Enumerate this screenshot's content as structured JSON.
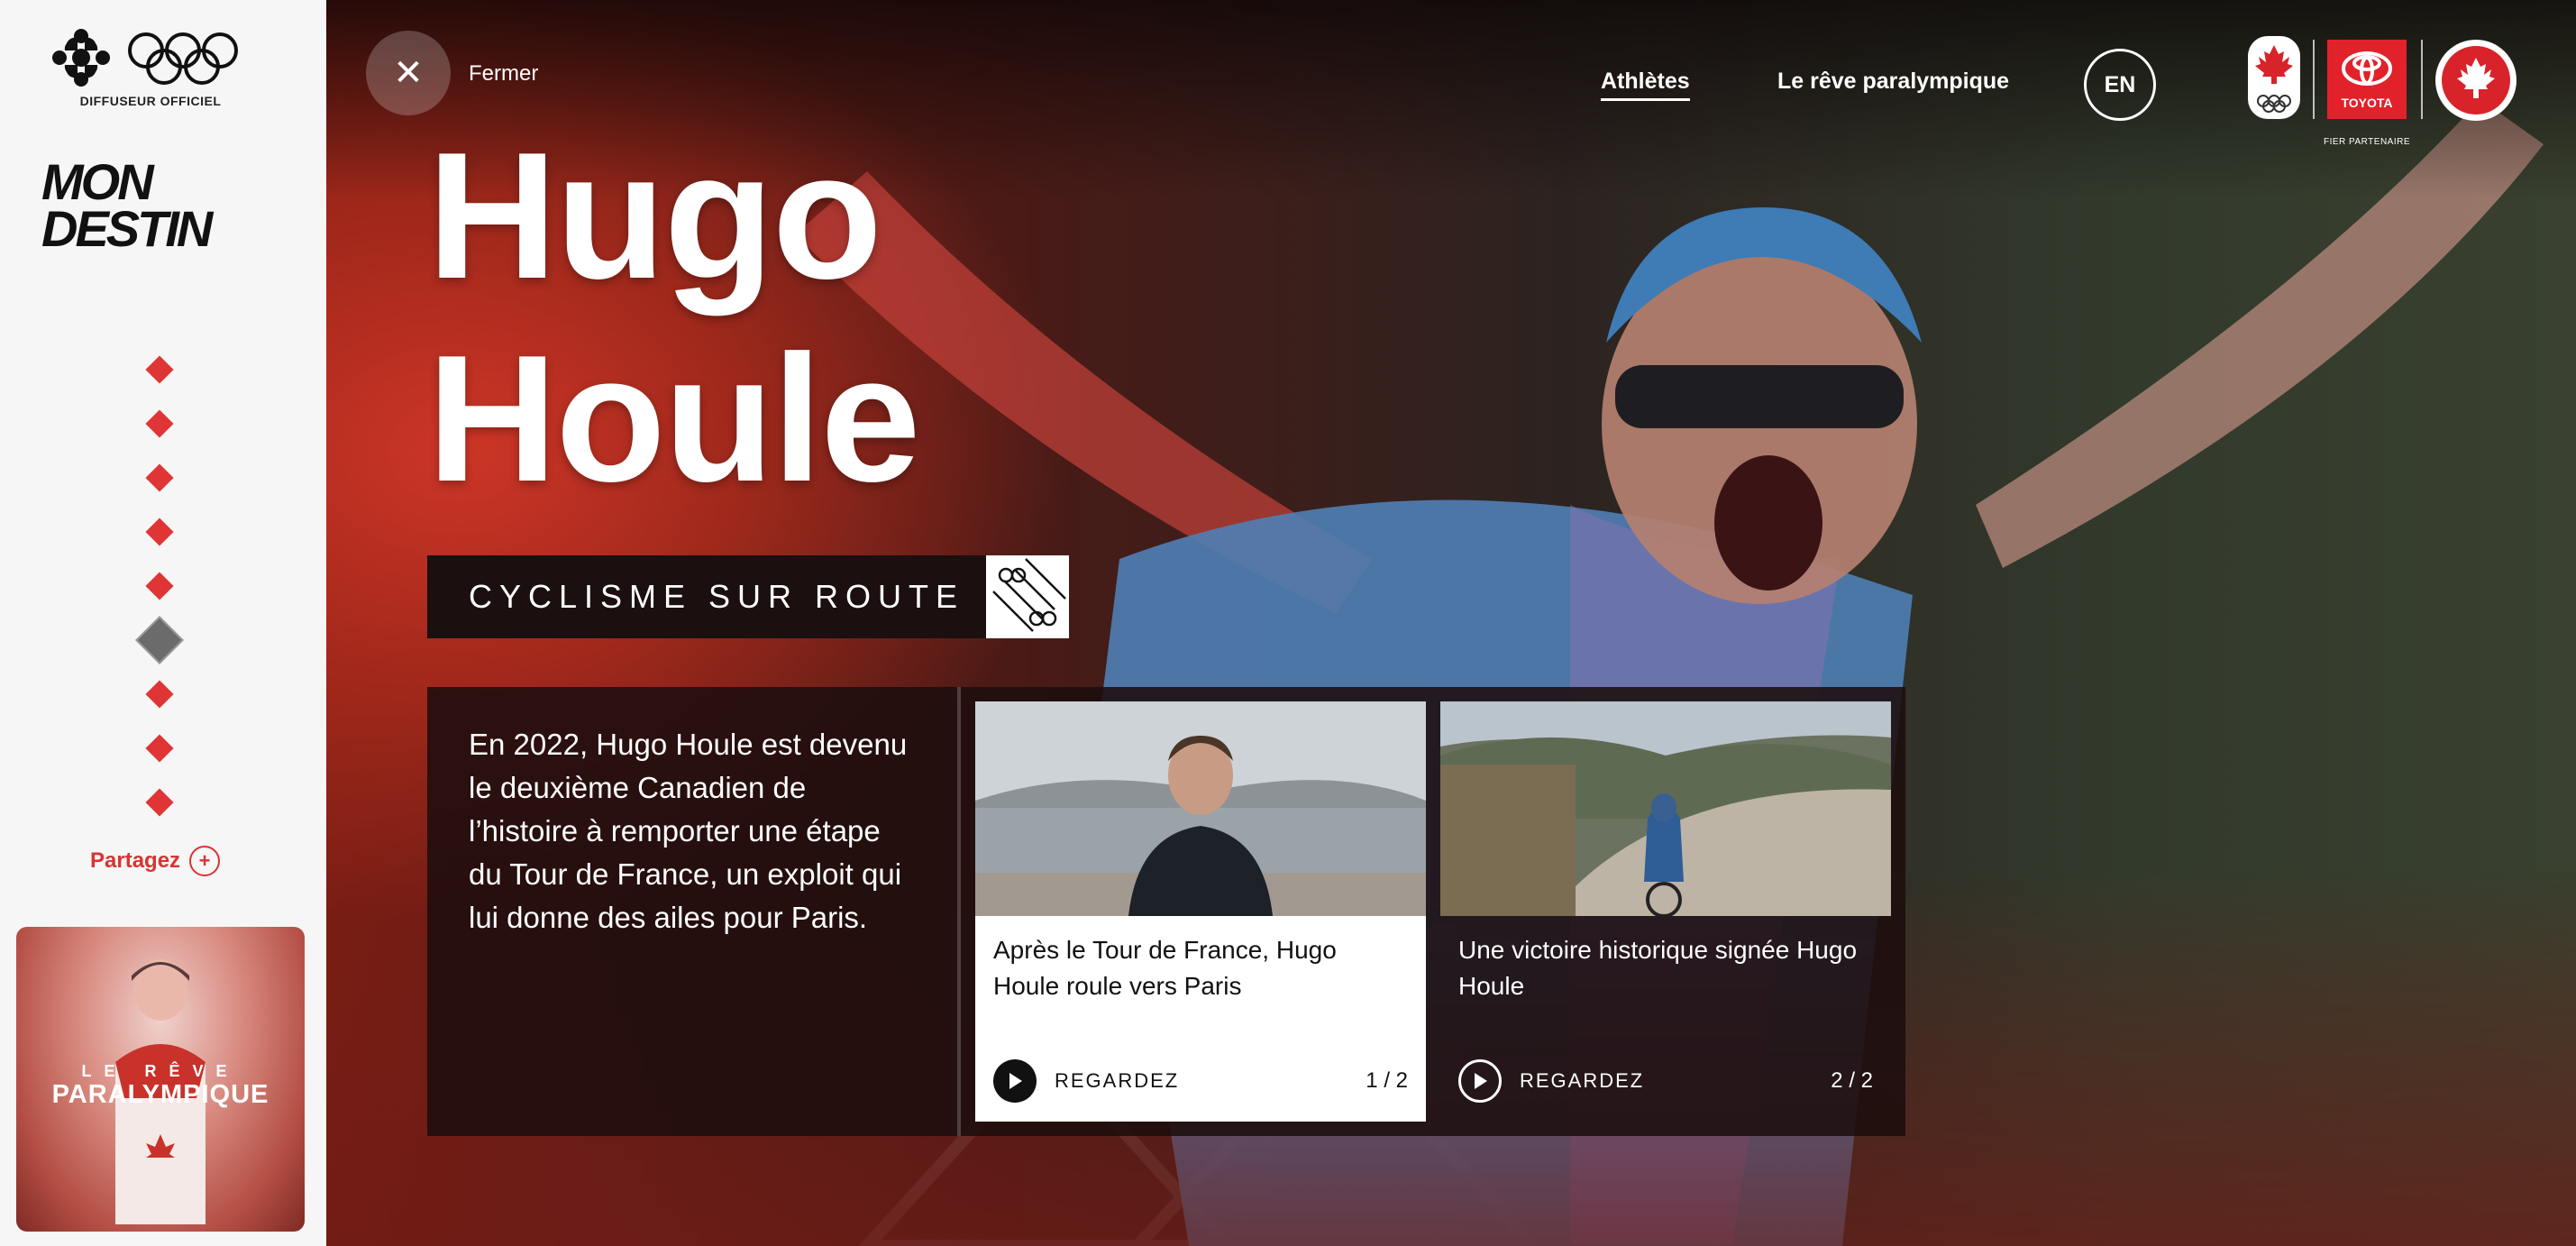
{
  "sidebar": {
    "broadcaster_label": "DIFFUSEUR OFFICIEL",
    "brand_line1": "MON",
    "brand_line2": "DESTIN",
    "nav_dots": [
      {
        "icon": "diamond-icon",
        "active": false
      },
      {
        "icon": "diamond-icon",
        "active": false
      },
      {
        "icon": "diamond-icon",
        "active": false
      },
      {
        "icon": "diamond-icon",
        "active": false
      },
      {
        "icon": "diamond-icon",
        "active": false
      },
      {
        "icon": "athlete-avatar-icon",
        "active": true
      },
      {
        "icon": "diamond-icon",
        "active": false
      },
      {
        "icon": "diamond-icon",
        "active": false
      },
      {
        "icon": "diamond-icon",
        "active": false
      }
    ],
    "share_label": "Partagez",
    "share_plus": "+",
    "promo": {
      "eyebrow": "LE RÊVE",
      "title": "PARALYMPIQUE"
    }
  },
  "header": {
    "close_label": "Fermer",
    "nav": [
      {
        "label": "Athlètes",
        "active": true
      },
      {
        "label": "Le rêve paralympique",
        "active": false
      }
    ],
    "language_toggle": "EN",
    "partner_label": "FIER PARTENAIRE",
    "toyota_label": "TOYOTA"
  },
  "athlete": {
    "first_name": "Hugo",
    "last_name": "Houle",
    "sport": "CYCLISME SUR ROUTE",
    "description": "En 2022, Hugo Houle est devenu le deuxième Canadien de l’histoire à remporter une étape du Tour de France, un exploit qui lui donne des ailes pour Paris."
  },
  "videos": [
    {
      "title": "Après le Tour de France, Hugo Houle roule vers Paris",
      "cta": "REGARDEZ",
      "counter": "1 / 2"
    },
    {
      "title": "Une victoire historique signée Hugo Houle",
      "cta": "REGARDEZ",
      "counter": "2 / 2"
    }
  ],
  "colors": {
    "accent": "#e03535",
    "panel": "#1c0e0e",
    "sidebar": "#f6f6f6"
  }
}
